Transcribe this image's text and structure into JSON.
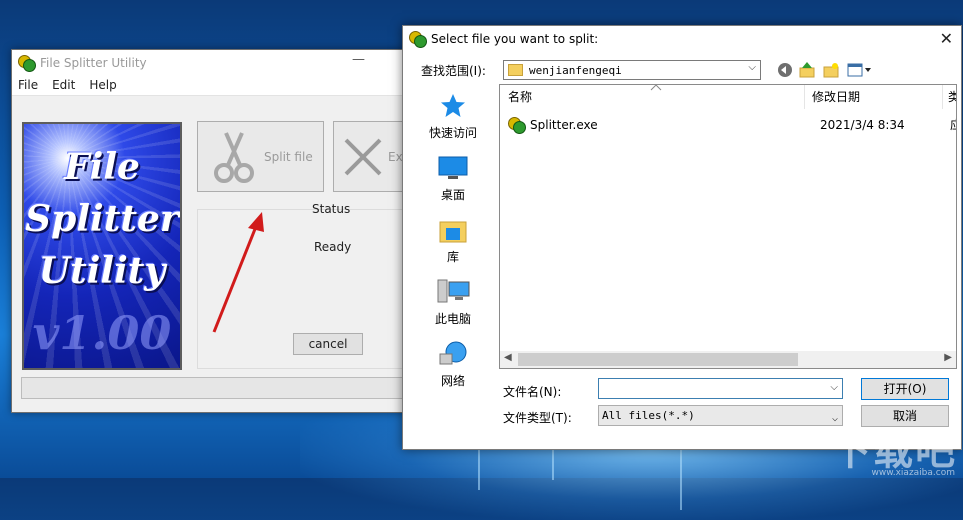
{
  "main_window": {
    "title": "File Splitter Utility",
    "minimize_glyph": "—",
    "menu": [
      "File",
      "Edit",
      "Help"
    ],
    "logo_words": [
      "File",
      "Splitter",
      "Utility"
    ],
    "logo_version": "v1.00",
    "split_button_label": "Split file",
    "exit_button_label": "Exit",
    "status_title": "Status",
    "status_text": "Ready",
    "cancel_label": "cancel",
    "progress_fraction": 0.0,
    "icons": [
      "app-icon",
      "scissors-icon",
      "x-icon"
    ]
  },
  "dialog": {
    "title": "Select file you want to split:",
    "close_glyph": "✕",
    "look_in_label": "查找范围(I):",
    "look_in_value": "wenjianfengeqi",
    "toolbar_icons": [
      "back-icon",
      "up-folder-icon",
      "new-folder-icon",
      "view-menu-icon"
    ],
    "places": [
      {
        "label": "快速访问",
        "icon": "star-icon"
      },
      {
        "label": "桌面",
        "icon": "desktop-icon"
      },
      {
        "label": "库",
        "icon": "library-icon"
      },
      {
        "label": "此电脑",
        "icon": "computer-icon"
      },
      {
        "label": "网络",
        "icon": "network-icon"
      }
    ],
    "columns": [
      "名称",
      "修改日期",
      "类"
    ],
    "files": [
      {
        "name": "Splitter.exe",
        "date": "2021/3/4 8:34",
        "type": "应"
      }
    ],
    "file_name_label": "文件名(N):",
    "file_name_value": "",
    "file_type_label": "文件类型(T):",
    "file_type_value": "All files(*.*)",
    "open_label": "打开(O)",
    "cancel_label": "取消"
  },
  "watermark": {
    "text": "下载吧",
    "url": "www.xiazaiba.com"
  },
  "colors": {
    "accent": "#0078d7",
    "progress": "#06b025",
    "logo_blue": "#1425b8"
  }
}
